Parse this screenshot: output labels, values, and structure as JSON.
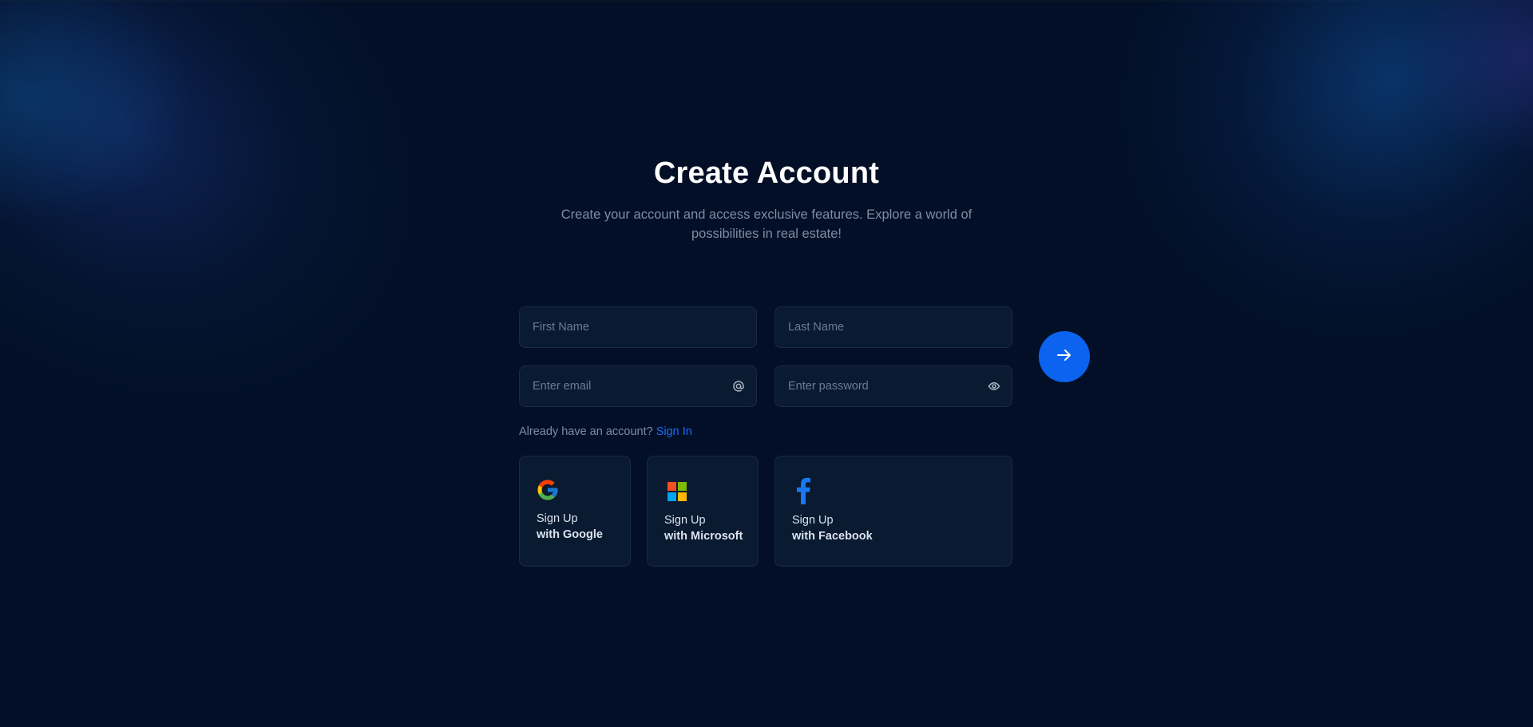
{
  "header": {
    "title": "Create Account",
    "subtitle": "Create your account and access exclusive features. Explore a world of possibilities in real estate!"
  },
  "form": {
    "first_name_placeholder": "First Name",
    "last_name_placeholder": "Last Name",
    "email_placeholder": "Enter email",
    "password_placeholder": "Enter password",
    "email_icon": "at-sign-icon",
    "password_icon": "eye-icon",
    "submit_icon": "arrow-right-icon"
  },
  "signin": {
    "prompt": "Already have an account?",
    "link": "Sign In"
  },
  "social": [
    {
      "line1": "Sign Up",
      "line2": "with Google",
      "icon": "google-icon"
    },
    {
      "line1": "Sign Up",
      "line2": "with Microsoft",
      "icon": "microsoft-icon"
    },
    {
      "line1": "Sign Up",
      "line2": "with Facebook",
      "icon": "facebook-icon"
    }
  ],
  "colors": {
    "background": "#020f26",
    "accent": "#0b63f0",
    "field_bg": "#0a1a30",
    "muted_text": "#7f8ca3"
  }
}
